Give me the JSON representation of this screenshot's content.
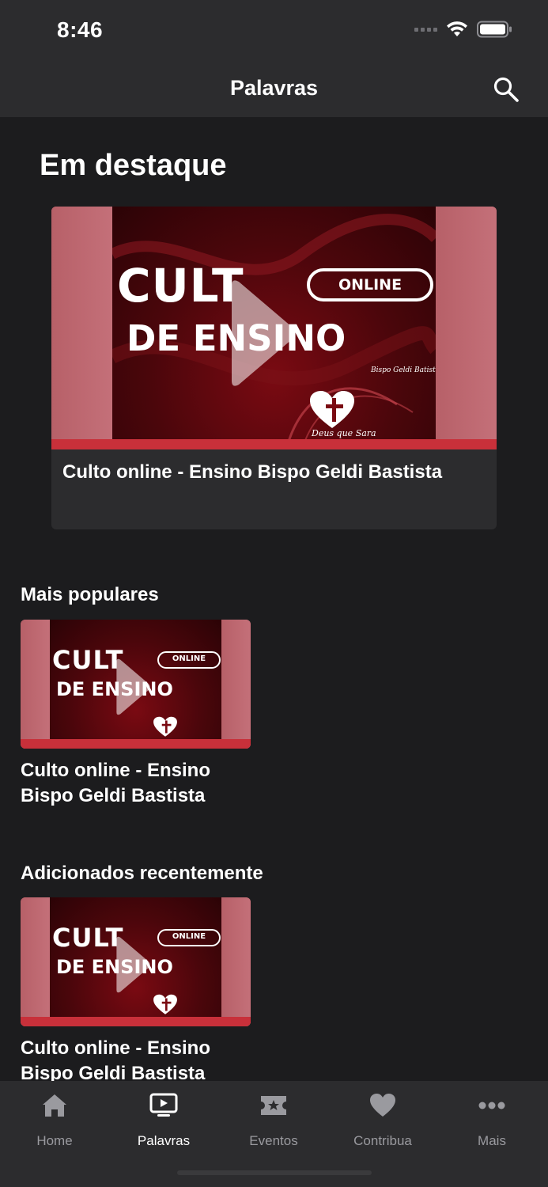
{
  "status_bar": {
    "time": "8:46"
  },
  "nav": {
    "title": "Palavras",
    "search_icon": "search-icon"
  },
  "featured": {
    "section_title": "Em destaque",
    "card_title": "Culto online - Ensino Bispo Geldi Bastista",
    "thumbnail": {
      "line1": "CULT",
      "badge": "ONLINE",
      "line2": "DE ENSINO",
      "subtitle": "Bispo Geldi Batista",
      "logo_text": "Deus que Sara"
    }
  },
  "popular": {
    "section_title": "Mais populares",
    "items": [
      {
        "title": "Culto online - Ensino Bispo Geldi Bastista"
      }
    ]
  },
  "recent": {
    "section_title": "Adicionados recentemente",
    "items": [
      {
        "title": "Culto online - Ensino Bispo Geldi Bastista"
      }
    ]
  },
  "tabs": [
    {
      "label": "Home",
      "icon": "home-icon",
      "active": false
    },
    {
      "label": "Palavras",
      "icon": "video-icon",
      "active": true
    },
    {
      "label": "Eventos",
      "icon": "ticket-icon",
      "active": false
    },
    {
      "label": "Contribua",
      "icon": "heart-icon",
      "active": false
    },
    {
      "label": "Mais",
      "icon": "more-icon",
      "active": false
    }
  ],
  "colors": {
    "background": "#1c1c1e",
    "bar": "#2c2c2e",
    "accent_red": "#c8303a",
    "tab_inactive": "#9a9a9f"
  }
}
